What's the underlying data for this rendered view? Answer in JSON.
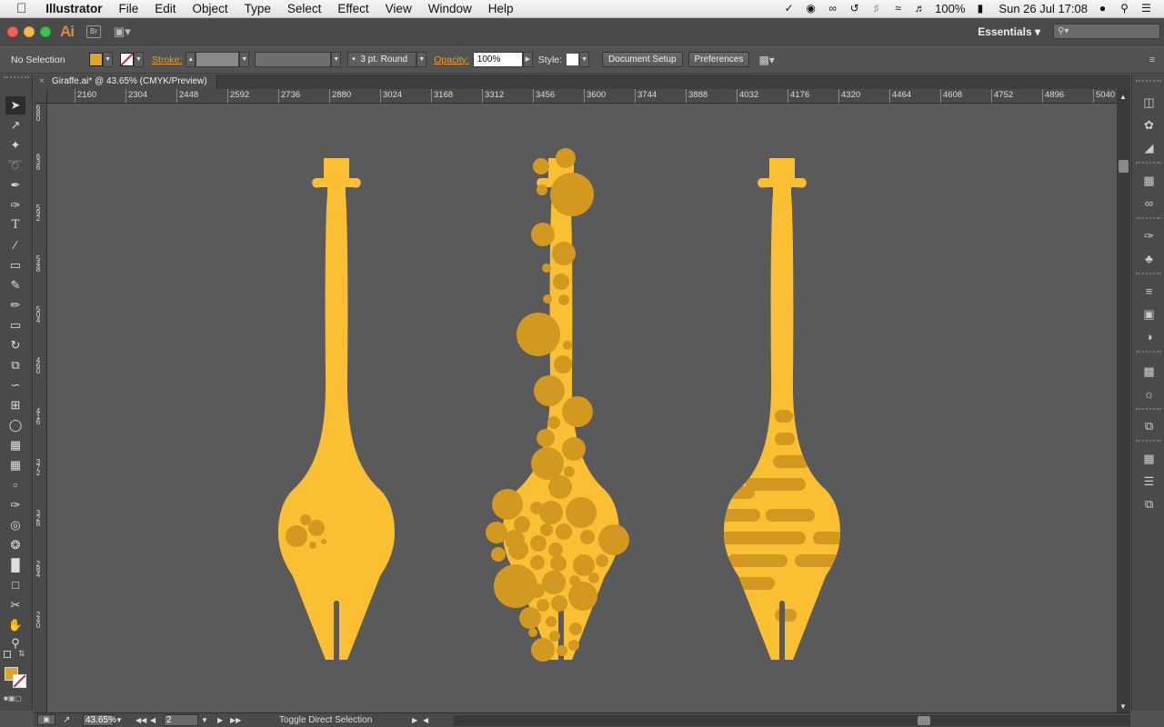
{
  "menubar": {
    "app_name": "Illustrator",
    "items": [
      "File",
      "Edit",
      "Object",
      "Type",
      "Select",
      "Effect",
      "View",
      "Window",
      "Help"
    ],
    "battery": "100%",
    "clock": "Sun 26 Jul  17:08"
  },
  "appbar": {
    "logo": "Ai",
    "bridge": "Br",
    "workspace": "Essentials",
    "search_placeholder": ""
  },
  "control": {
    "selection": "No Selection",
    "fill_color": "#e0a323",
    "stroke_label": "Stroke:",
    "brush": "3 pt. Round",
    "opacity_label": "Opacity:",
    "opacity_value": "100%",
    "style_label": "Style:",
    "document_setup": "Document Setup",
    "preferences": "Preferences"
  },
  "document": {
    "tab_title": "Giraffe.ai* @ 43.65% (CMYK/Preview)"
  },
  "ruler": {
    "h_ticks": [
      "2160",
      "2304",
      "2448",
      "2592",
      "2736",
      "2880",
      "3024",
      "3168",
      "3312",
      "3456",
      "3600",
      "3744",
      "3888",
      "4032",
      "4176",
      "4320",
      "4464",
      "4608",
      "4752",
      "4896",
      "5040"
    ],
    "v_ticks": [
      "680",
      "636",
      "592",
      "548",
      "504",
      "460",
      "416",
      "372",
      "328",
      "284",
      "240"
    ]
  },
  "status": {
    "zoom": "43.65%",
    "artboard": "2",
    "tool_hint": "Toggle Direct Selection"
  },
  "colors": {
    "giraffe": "#fbbf33",
    "spots": "#d3981f",
    "canvas": "#5a5a5a"
  }
}
